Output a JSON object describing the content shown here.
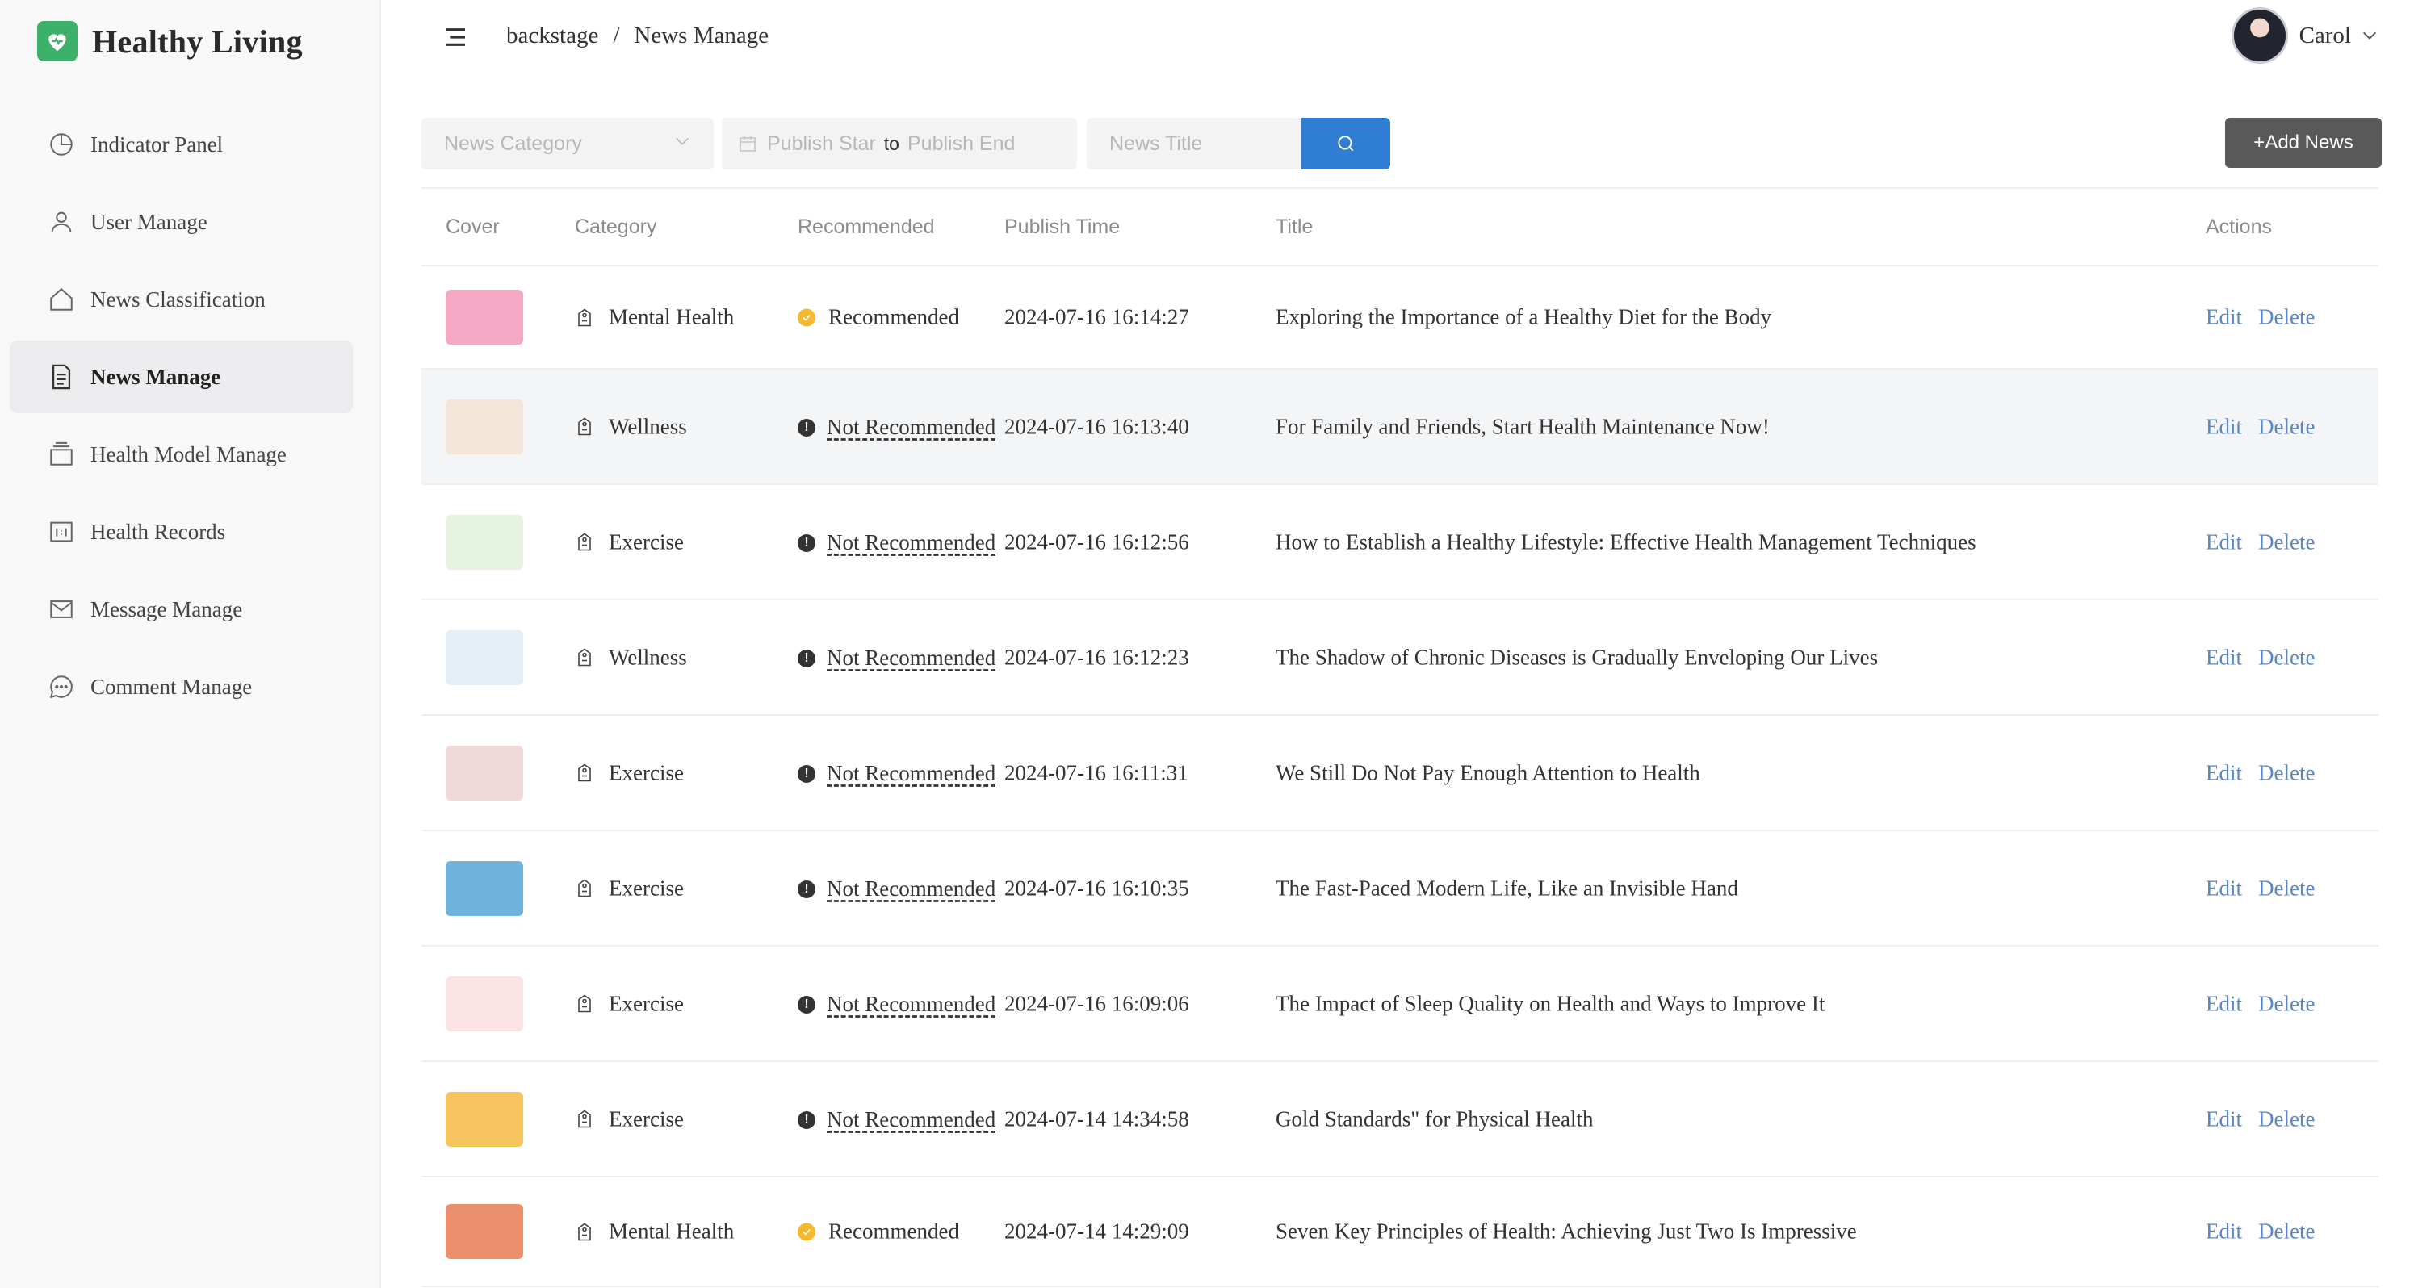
{
  "brand": {
    "title": "Healthy Living"
  },
  "sidebar": {
    "items": [
      {
        "label": "Indicator Panel",
        "icon": "pie-chart-icon"
      },
      {
        "label": "User Manage",
        "icon": "user-icon"
      },
      {
        "label": "News Classification",
        "icon": "home-icon"
      },
      {
        "label": "News Manage",
        "icon": "document-icon",
        "active": true
      },
      {
        "label": "Health Model Manage",
        "icon": "layers-icon"
      },
      {
        "label": "Health Records",
        "icon": "calendar-icon"
      },
      {
        "label": "Message Manage",
        "icon": "mail-icon"
      },
      {
        "label": "Comment Manage",
        "icon": "chat-icon"
      }
    ]
  },
  "header": {
    "breadcrumb": [
      "backstage",
      "/",
      "News Manage"
    ],
    "user": {
      "name": "Carol"
    }
  },
  "filters": {
    "category_placeholder": "News Category",
    "publish_start_placeholder": "Publish Star",
    "range_separator": "to",
    "publish_end_placeholder": "Publish End",
    "title_placeholder": "News Title",
    "add_label": "+Add News"
  },
  "table": {
    "columns": [
      "Cover",
      "Category",
      "Recommended",
      "Publish Time",
      "Title",
      "Actions"
    ],
    "edit_label": "Edit",
    "delete_label": "Delete",
    "rows": [
      {
        "category": "Mental Health",
        "recommended": "Recommended",
        "is_recommended": true,
        "time": "2024-07-16 16:14:27",
        "title": "Exploring the Importance of a Healthy Diet for the Body",
        "cover_color": "#f4a8c4"
      },
      {
        "category": "Wellness",
        "recommended": "Not Recommended",
        "is_recommended": false,
        "time": "2024-07-16 16:13:40",
        "title": "For Family and Friends, Start Health Maintenance Now!",
        "cover_color": "#f3e6d8"
      },
      {
        "category": "Exercise",
        "recommended": "Not Recommended",
        "is_recommended": false,
        "time": "2024-07-16 16:12:56",
        "title": "How to Establish a Healthy Lifestyle: Effective Health Management Techniques",
        "cover_color": "#e6f3e1"
      },
      {
        "category": "Wellness",
        "recommended": "Not Recommended",
        "is_recommended": false,
        "time": "2024-07-16 16:12:23",
        "title": "The Shadow of Chronic Diseases is Gradually Enveloping Our Lives",
        "cover_color": "#e4eef7"
      },
      {
        "category": "Exercise",
        "recommended": "Not Recommended",
        "is_recommended": false,
        "time": "2024-07-16 16:11:31",
        "title": "We Still Do Not Pay Enough Attention to Health",
        "cover_color": "#f0d9d9"
      },
      {
        "category": "Exercise",
        "recommended": "Not Recommended",
        "is_recommended": false,
        "time": "2024-07-16 16:10:35",
        "title": "The Fast-Paced Modern Life, Like an Invisible Hand",
        "cover_color": "#6fb2dc"
      },
      {
        "category": "Exercise",
        "recommended": "Not Recommended",
        "is_recommended": false,
        "time": "2024-07-16 16:09:06",
        "title": "The Impact of Sleep Quality on Health and Ways to Improve It",
        "cover_color": "#fbe3e3"
      },
      {
        "category": "Exercise",
        "recommended": "Not Recommended",
        "is_recommended": false,
        "time": "2024-07-14 14:34:58",
        "title": "Gold Standards\" for Physical Health",
        "cover_color": "#f6c560"
      },
      {
        "category": "Mental Health",
        "recommended": "Recommended",
        "is_recommended": true,
        "time": "2024-07-14 14:29:09",
        "title": "Seven Key Principles of Health: Achieving Just Two Is Impressive",
        "cover_color": "#e98f6e"
      }
    ]
  }
}
